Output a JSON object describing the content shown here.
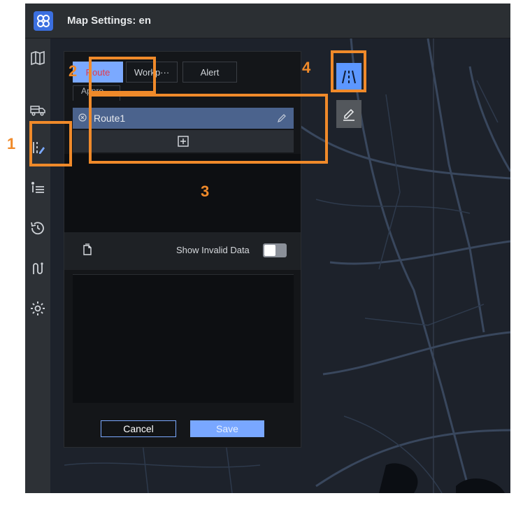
{
  "window": {
    "title": "Map Settings: en"
  },
  "sidebar": {
    "items": [
      {
        "icon": "map-icon",
        "label": ""
      },
      {
        "icon": "truck-icon",
        "label": ""
      },
      {
        "icon": "route-settings-icon",
        "label": ""
      },
      {
        "icon": "list-icon",
        "label": ""
      },
      {
        "icon": "history-icon",
        "label": ""
      },
      {
        "icon": "path-icon",
        "label": ""
      },
      {
        "icon": "gear-icon",
        "label": ""
      }
    ]
  },
  "panel": {
    "tabs": [
      {
        "label": "Route",
        "active": true
      },
      {
        "label": "Workp···",
        "active": false
      },
      {
        "label": "Alert",
        "active": false
      },
      {
        "label": "Appro···",
        "active": false
      }
    ],
    "routes": [
      {
        "name": "Route1"
      }
    ],
    "show_invalid_label": "Show Invalid Data",
    "show_invalid_on": false,
    "cancel_label": "Cancel",
    "save_label": "Save"
  },
  "tools": [
    {
      "icon": "road-icon",
      "active": true
    },
    {
      "icon": "pencil-icon",
      "active": false
    }
  ],
  "annotations": [
    "1",
    "2",
    "3",
    "4"
  ],
  "colors": {
    "accent": "#7ba9ff",
    "annotation": "#f08a2a",
    "route_row": "#4b638d",
    "tab_text": "#e23a4c"
  }
}
